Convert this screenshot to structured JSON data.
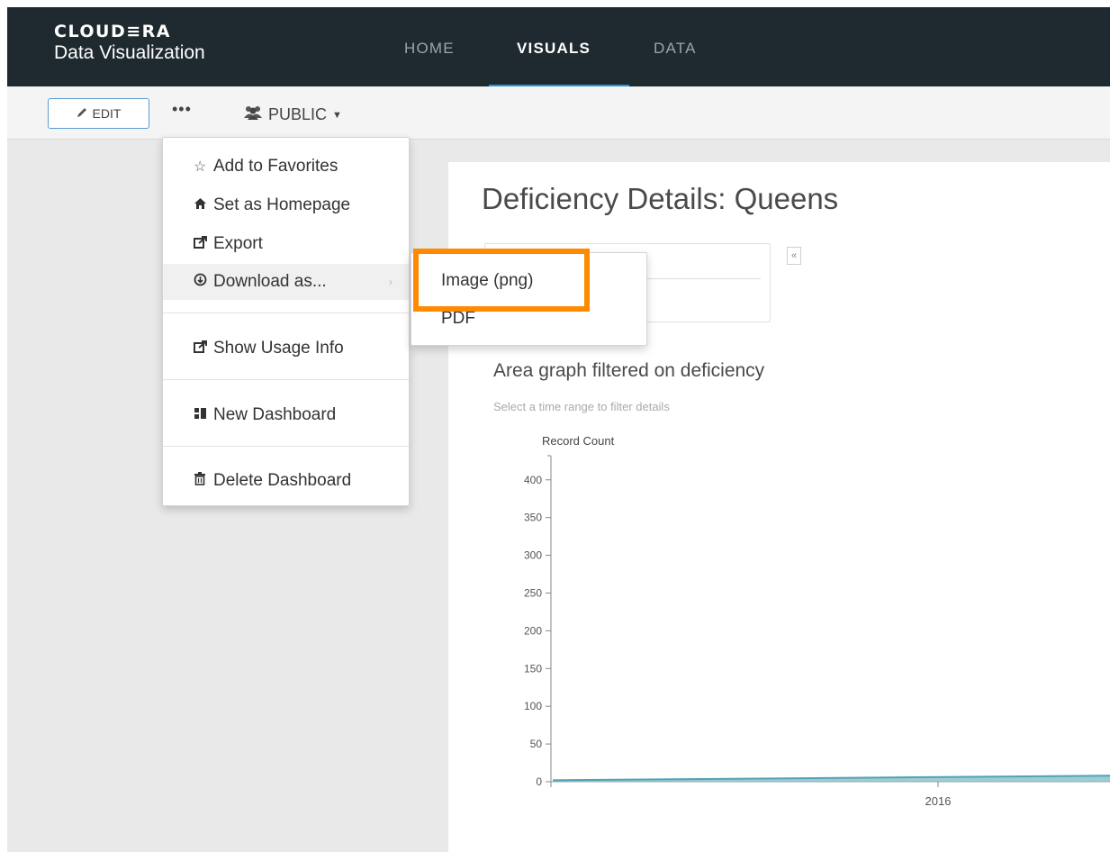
{
  "header": {
    "brand_name": "CLOUD≡RA",
    "brand_sub": "Data Visualization",
    "nav": [
      {
        "label": "HOME",
        "active": false
      },
      {
        "label": "VISUALS",
        "active": true
      },
      {
        "label": "DATA",
        "active": false
      }
    ]
  },
  "toolbar": {
    "edit_label": "EDIT",
    "more_label": "•••",
    "public_label": "PUBLIC"
  },
  "menu": {
    "items": [
      {
        "label": "Add to Favorites",
        "icon": "star-icon"
      },
      {
        "label": "Set as Homepage",
        "icon": "home-icon"
      },
      {
        "label": "Export",
        "icon": "export-icon"
      },
      {
        "label": "Download as...",
        "icon": "download-icon"
      },
      {
        "label": "Show Usage Info",
        "icon": "usage-info-icon"
      },
      {
        "label": "New Dashboard",
        "icon": "dashboard-icon"
      },
      {
        "label": "Delete Dashboard",
        "icon": "trash-icon"
      }
    ]
  },
  "submenu": {
    "items": [
      "Image (png)",
      "PDF"
    ]
  },
  "dashboard": {
    "title": "Deficiency Details: Queens",
    "viz_title": "Area graph filtered on deficiency",
    "viz_subtitle": "Select a time range to filter details"
  },
  "chart_data": {
    "type": "area",
    "ylabel": "Record Count",
    "ylim": [
      0,
      420
    ],
    "yticks": [
      0,
      50,
      100,
      150,
      200,
      250,
      300,
      350,
      400
    ],
    "x_tick_labels": [
      "2016"
    ],
    "series": [
      {
        "x": [
          0,
          1
        ],
        "values": [
          2,
          8
        ]
      }
    ],
    "color": "#4ea3b5"
  },
  "colors": {
    "header_bg": "#1f2a30",
    "accent": "#2f93d6",
    "highlight": "#ff8a00"
  }
}
